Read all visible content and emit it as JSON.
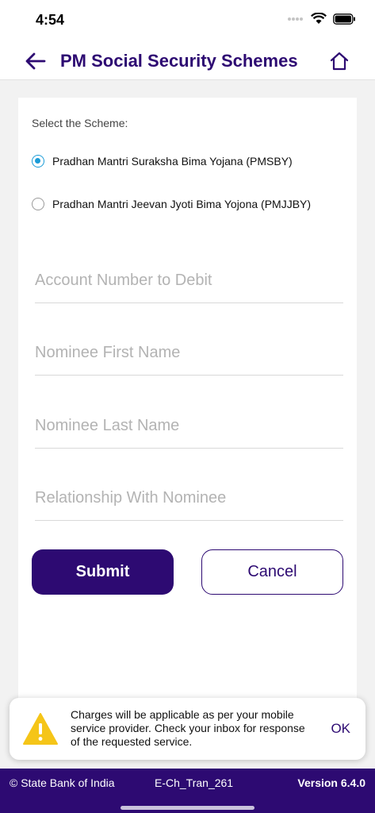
{
  "status_bar": {
    "time": "4:54"
  },
  "nav": {
    "title": "PM Social Security Schemes"
  },
  "form": {
    "select_label": "Select the Scheme:",
    "schemes": [
      {
        "label": "Pradhan Mantri Suraksha Bima Yojana (PMSBY)",
        "selected": true
      },
      {
        "label": "Pradhan Mantri Jeevan Jyoti Bima Yojona (PMJJBY)",
        "selected": false
      }
    ],
    "fields": {
      "account_placeholder": "Account Number to Debit",
      "nominee_first_placeholder": "Nominee First Name",
      "nominee_last_placeholder": "Nominee Last Name",
      "relationship_placeholder": "Relationship With Nominee"
    },
    "submit_label": "Submit",
    "cancel_label": "Cancel"
  },
  "toast": {
    "message": "Charges will be applicable as per your mobile service provider. Check your inbox for response of the requested service.",
    "ok_label": "OK"
  },
  "footer": {
    "copyright": "© State Bank of India",
    "code": "E-Ch_Tran_261",
    "version": "Version 6.4.0"
  },
  "colors": {
    "brand": "#2d0a72",
    "radio_selected": "#1a9bd7",
    "warning": "#f5c518"
  }
}
